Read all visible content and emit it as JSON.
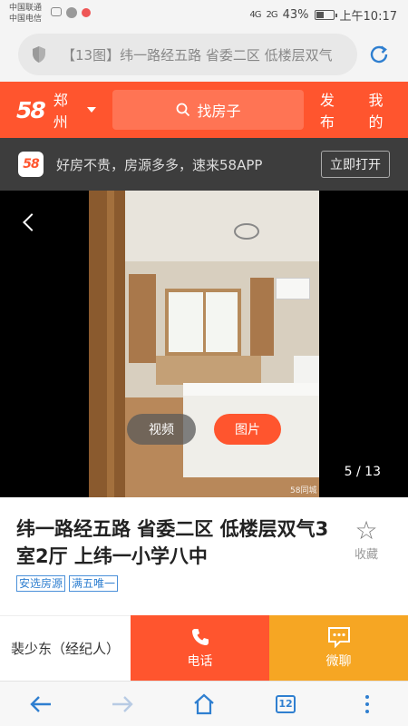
{
  "status": {
    "carrier1": "中国联通",
    "carrier2": "中国电信",
    "signal_left": "4G",
    "signal_right": "2G",
    "battery": "43%",
    "battery_level": 0.43,
    "time": "上午10:17"
  },
  "browser": {
    "url_text": "【13图】纬一路经五路 省委二区 低楼层双气"
  },
  "header": {
    "logo": "58",
    "city": "郑州",
    "search_label": "找房子",
    "publish": "发布",
    "mine": "我的"
  },
  "app_banner": {
    "logo": "58",
    "text": "好房不贵，房源多多，速来58APP",
    "open_label": "立即打开"
  },
  "gallery": {
    "video_label": "视频",
    "picture_label": "图片",
    "pager": "5 / 13",
    "watermark": "58同城"
  },
  "listing": {
    "title": "纬一路经五路 省委二区 低楼层双气3室2厅 上纬一小学八中",
    "favorite_label": "收藏",
    "tags": [
      "安选房源",
      "满五唯一"
    ]
  },
  "contact": {
    "agent": "裴少东（经纪人）",
    "call_label": "电话",
    "chat_label": "微聊"
  },
  "nav": {
    "tab_count": "12"
  },
  "colors": {
    "brand": "#ff552e",
    "chat": "#f6a623",
    "link": "#2f7fd0"
  }
}
